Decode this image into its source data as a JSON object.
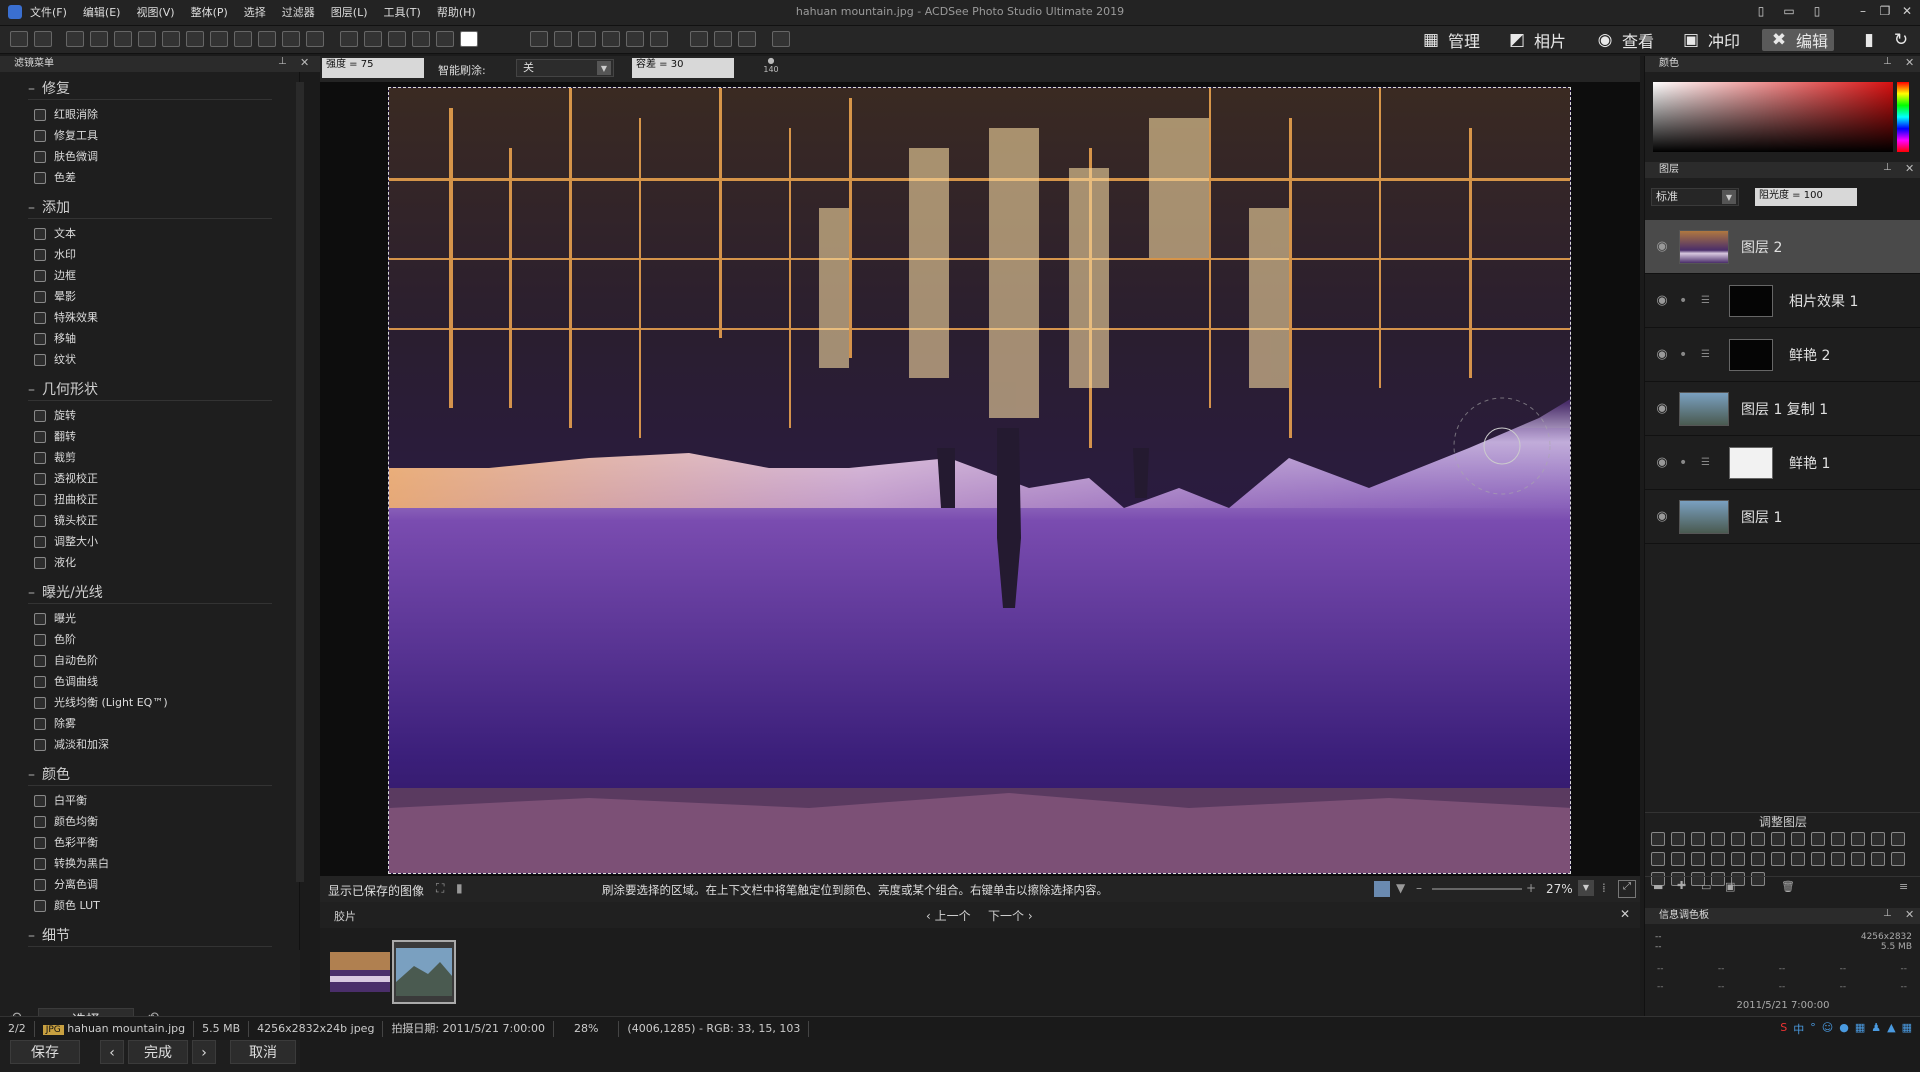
{
  "window": {
    "title": "hahuan mountain.jpg - ACDSee Photo Studio Ultimate 2019",
    "menu": [
      "文件(F)",
      "编辑(E)",
      "视图(V)",
      "整体(P)",
      "选择",
      "过滤器",
      "图层(L)",
      "工具(T)",
      "帮助(H)"
    ]
  },
  "modes": [
    {
      "label": "管理",
      "icon": "grid-icon"
    },
    {
      "label": "相片",
      "icon": "photo-icon"
    },
    {
      "label": "查看",
      "icon": "eye-icon"
    },
    {
      "label": "冲印",
      "icon": "develop-icon"
    },
    {
      "label": "编辑",
      "icon": "edit-icon",
      "active": true
    }
  ],
  "options": {
    "strength": "强度 = 75",
    "smart_brush_label": "智能刷涂:",
    "smart_brush_value": "关",
    "tolerance": "容差 = 30",
    "brush_size": "140"
  },
  "left_panel": {
    "title": "滤镜菜单",
    "groups": [
      {
        "name": "修复",
        "items": [
          "红眼消除",
          "修复工具",
          "肤色微调",
          "色差"
        ]
      },
      {
        "name": "添加",
        "items": [
          "文本",
          "水印",
          "边框",
          "晕影",
          "特殊效果",
          "移轴",
          "纹状"
        ]
      },
      {
        "name": "几何形状",
        "items": [
          "旋转",
          "翻转",
          "裁剪",
          "透视校正",
          "扭曲校正",
          "镜头校正",
          "调整大小",
          "液化"
        ]
      },
      {
        "name": "曝光/光线",
        "items": [
          "曝光",
          "色阶",
          "自动色阶",
          "色调曲线",
          "光线均衡 (Light EQ™)",
          "除雾",
          "减淡和加深"
        ]
      },
      {
        "name": "颜色",
        "items": [
          "白平衡",
          "颜色均衡",
          "色彩平衡",
          "转换为黑白",
          "分离色调",
          "颜色 LUT"
        ]
      },
      {
        "name": "细节",
        "items": []
      }
    ],
    "select_button": "选择",
    "save_button": "保存",
    "done_button": "完成",
    "cancel_button": "取消"
  },
  "status_line": {
    "show_saved": "显示已保存的图像",
    "hint": "刷涂要选择的区域。在上下文栏中将笔触定位到颜色、亮度或某个组合。右键单击以擦除选择内容。",
    "zoom": "27%"
  },
  "filmstrip": {
    "title": "胶片",
    "prev": "上一个",
    "next": "下一个"
  },
  "right_panel": {
    "color_title": "颜色",
    "layers_title": "图层",
    "blend_mode": "标准",
    "opacity": "阻光度 = 100",
    "layers": [
      {
        "name": "图层 2",
        "type": "image",
        "selected": true
      },
      {
        "name": "相片效果 1",
        "type": "mask-dark"
      },
      {
        "name": "鲜艳 2",
        "type": "mask-dark"
      },
      {
        "name": "图层 1 复制 1",
        "type": "image"
      },
      {
        "name": "鲜艳 1",
        "type": "mask-light"
      },
      {
        "name": "图层 1",
        "type": "image"
      }
    ],
    "adjust_title": "调整图层",
    "info_title": "信息调色板",
    "info_dims": "4256x2832",
    "info_size": "5.5 MB",
    "info_date": "2011/5/21 7:00:00"
  },
  "bottom_status": {
    "count": "2/2",
    "format": "JPG",
    "filename": "hahuan mountain.jpg",
    "filesize": "5.5 MB",
    "dimensions": "4256x2832x24b jpeg",
    "date": "拍摄日期: 2011/5/21 7:00:00",
    "zoom": "28%",
    "pixel": "(4006,1285) - RGB: 33, 15, 103"
  },
  "colors": {
    "accent": "#5a5a5a",
    "photo_sky": "#3b1f7a"
  }
}
